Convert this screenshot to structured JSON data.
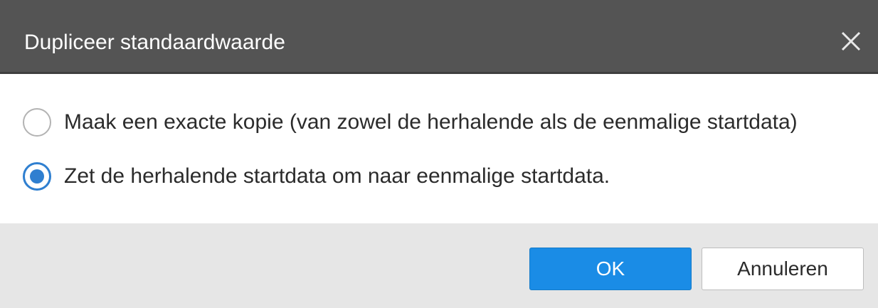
{
  "dialog": {
    "title": "Dupliceer standaardwaarde",
    "close_icon": "close-icon"
  },
  "options": [
    {
      "label": "Maak een exacte kopie (van zowel de herhalende als de eenmalige startdata)",
      "selected": false
    },
    {
      "label": "Zet de herhalende startdata om naar eenmalige startdata.",
      "selected": true
    }
  ],
  "buttons": {
    "ok_label": "OK",
    "cancel_label": "Annuleren"
  },
  "colors": {
    "titlebar": "#545454",
    "accent": "#1a8ce6",
    "radio_checked": "#2f7fd0",
    "footer": "#e6e6e6"
  }
}
